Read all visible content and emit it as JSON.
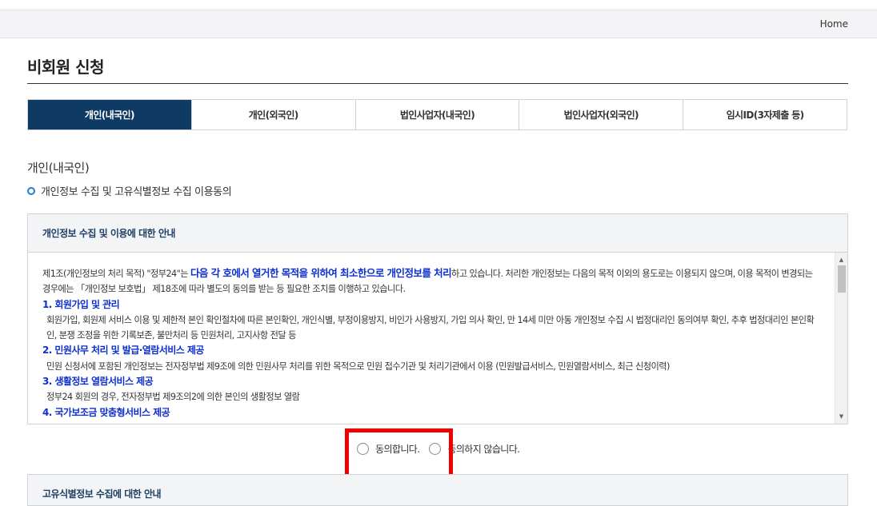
{
  "header": {
    "home_label": "Home"
  },
  "page_title": "비회원 신청",
  "tabs": [
    {
      "label": "개인(내국인)",
      "active": true
    },
    {
      "label": "개인(외국인)",
      "active": false
    },
    {
      "label": "법인사업자(내국인)",
      "active": false
    },
    {
      "label": "법인사업자(외국인)",
      "active": false
    },
    {
      "label": "임시ID(3자제출 등)",
      "active": false
    }
  ],
  "section": {
    "title": "개인(내국인)",
    "consent_heading": "개인정보 수집 및 고유식별정보 수집 이용동의"
  },
  "privacy_panel": {
    "heading": "개인정보 수집 및 이용에 대한 안내",
    "intro_prefix": "제1조(개인정보의 처리 목적) \"정부24\"는 ",
    "intro_highlight": "다음 각 호에서 열거한 목적을 위하여 최소한으로 개인정보를 처리",
    "intro_suffix": "하고 있습니다. 처리한 개인정보는 다음의 목적 이외의 용도로는 이용되지 않으며, 이용 목적이 변경되는 경우에는 「개인정보 보호법」 제18조에 따라 별도의 동의를 받는 등 필요한 조치를 이행하고 있습니다.",
    "items": [
      {
        "title": "1. 회원가입 및 관리",
        "text": "회원가입, 회원제 서비스 이용 및 제한적 본인 확인절차에 따른 본인확인, 개인식별, 부정이용방지, 비인가 사용방지, 가입 의사 확인, 만 14세 미만 아동 개인정보 수집 시 법정대리인 동의여부 확인, 추후 법정대리인 본인확인, 분쟁 조정을 위한 기록보존, 불만처리 등 민원처리, 고지사항 전달 등"
      },
      {
        "title": "2. 민원사무 처리 및 발급·열람서비스 제공",
        "text": "민원 신청서에 포함된 개인정보는 전자정부법 제9조에 의한 민원사무 처리를 위한 목적으로 민원 접수기관 및 처리기관에서 이용 (민원발급서비스, 민원열람서비스, 최근 신청이력)"
      },
      {
        "title": "3. 생활정보 열람서비스 제공",
        "text": "정부24 회원의 경우, 전자정부법 제9조의2에 의한 본인의 생활정보 열람"
      },
      {
        "title": "4. 국가보조금 맞춤형서비스 제공",
        "text": ""
      }
    ]
  },
  "consent": {
    "agree_label": "동의합니다.",
    "disagree_label": "동의하지 않습니다.",
    "highlight_color": "#ee0000"
  },
  "unique_id_panel": {
    "heading": "고유식별정보 수집에 대한 안내"
  },
  "colors": {
    "active_tab": "#0e3a64",
    "highlight_text": "#0c2fd0",
    "bullet": "#1a7fd1"
  }
}
